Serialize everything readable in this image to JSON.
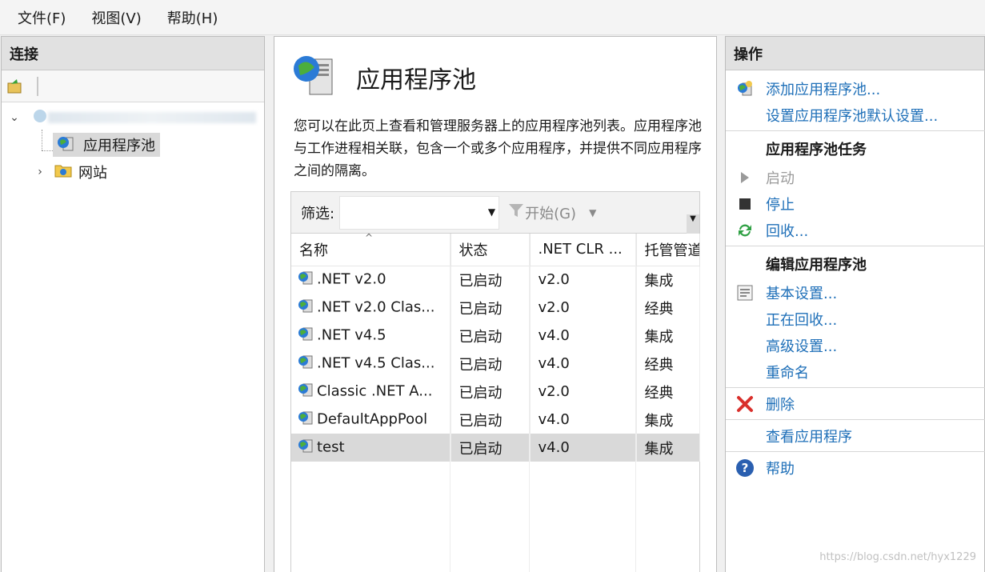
{
  "menubar": {
    "file": "文件(F)",
    "view": "视图(V)",
    "help": "帮助(H)"
  },
  "left": {
    "header": "连接",
    "tree": {
      "server": "",
      "app_pools": "应用程序池",
      "sites": "网站"
    }
  },
  "center": {
    "title": "应用程序池",
    "description": "您可以在此页上查看和管理服务器上的应用程序池列表。应用程序池与工作进程相关联，包含一个或多个应用程序，并提供不同应用程序之间的隔离。",
    "filter_label": "筛选:",
    "filter_value": "",
    "go_label": "开始(G)",
    "columns": [
      "名称",
      "状态",
      ".NET CLR ...",
      "托管管道"
    ],
    "rows": [
      {
        "name": ".NET v2.0",
        "status": "已启动",
        "clr": "v2.0",
        "pipeline": "集成"
      },
      {
        "name": ".NET v2.0 Clas...",
        "status": "已启动",
        "clr": "v2.0",
        "pipeline": "经典"
      },
      {
        "name": ".NET v4.5",
        "status": "已启动",
        "clr": "v4.0",
        "pipeline": "集成"
      },
      {
        "name": ".NET v4.5 Clas...",
        "status": "已启动",
        "clr": "v4.0",
        "pipeline": "经典"
      },
      {
        "name": "Classic .NET A...",
        "status": "已启动",
        "clr": "v2.0",
        "pipeline": "经典"
      },
      {
        "name": "DefaultAppPool",
        "status": "已启动",
        "clr": "v4.0",
        "pipeline": "集成"
      },
      {
        "name": "test",
        "status": "已启动",
        "clr": "v4.0",
        "pipeline": "集成"
      }
    ]
  },
  "right": {
    "header": "操作",
    "add_pool": "添加应用程序池...",
    "set_defaults": "设置应用程序池默认设置...",
    "tasks_title": "应用程序池任务",
    "start": "启动",
    "stop": "停止",
    "recycle": "回收...",
    "edit_title": "编辑应用程序池",
    "basic_settings": "基本设置...",
    "recycling": "正在回收...",
    "advanced_settings": "高级设置...",
    "rename": "重命名",
    "delete": "删除",
    "view_apps": "查看应用程序",
    "help": "帮助"
  },
  "watermark": "https://blog.csdn.net/hyx1229",
  "colors": {
    "link": "#1e6fb8",
    "header_bg": "#e1e1e1",
    "selected_bg": "#d9d9d9",
    "delete_red": "#d9302c"
  }
}
